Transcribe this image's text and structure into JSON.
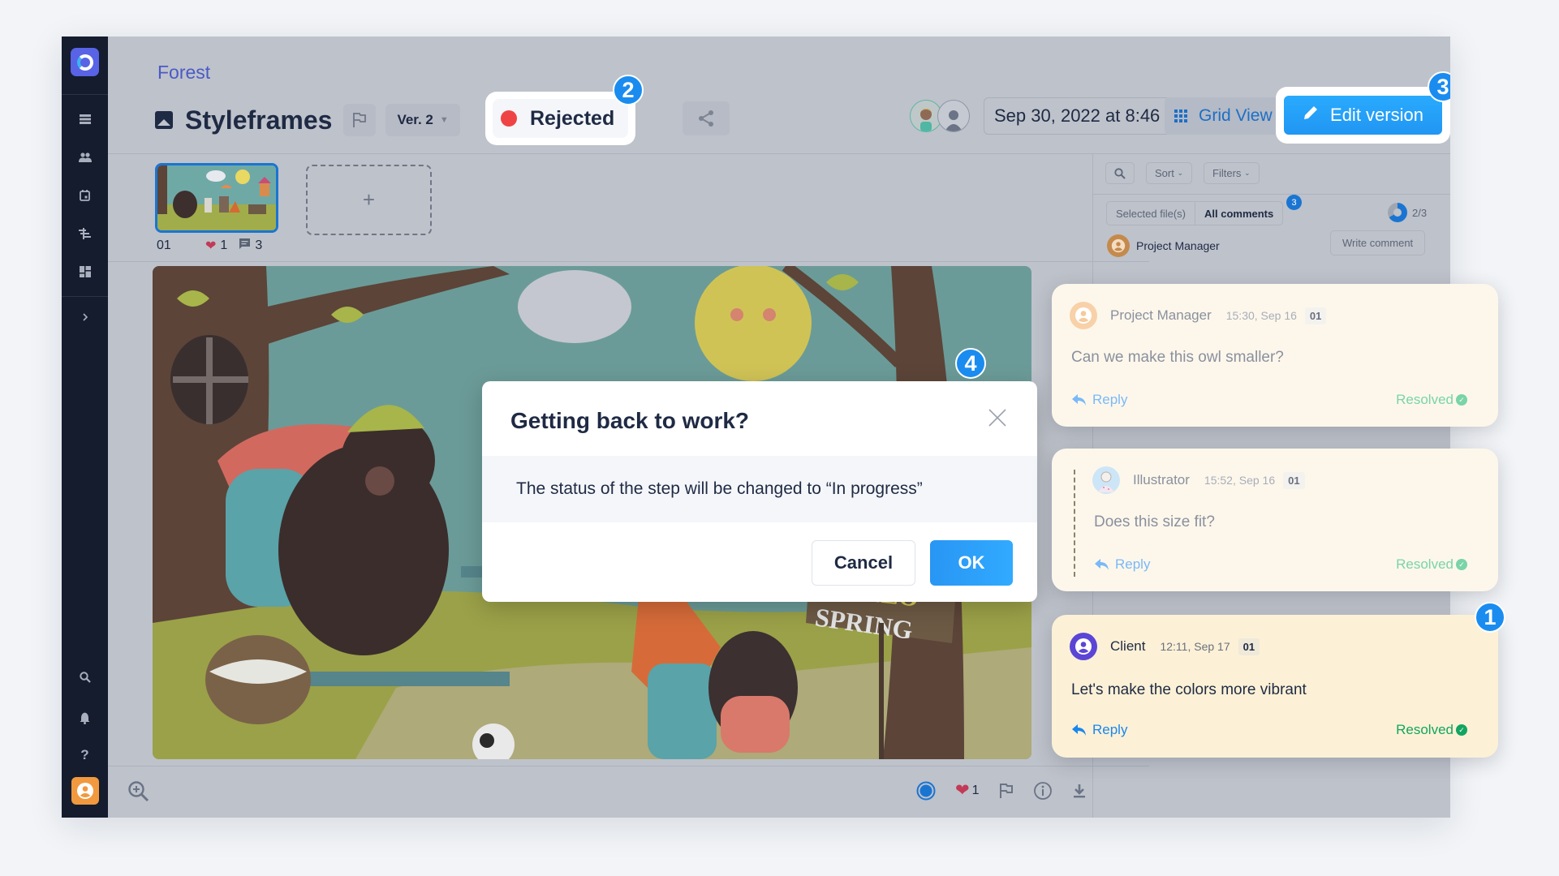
{
  "sidebar": {
    "nav_icons": [
      "list-icon",
      "team-icon",
      "calendar-icon",
      "timeline-icon",
      "dashboard-icon"
    ],
    "expand_icon": "chevron-right-icon",
    "bottom_icons": [
      "search-icon",
      "bell-icon",
      "help-icon"
    ],
    "help_glyph": "?"
  },
  "header": {
    "breadcrumb": "Forest",
    "title": "Styleframes",
    "version": "Ver. 2",
    "status": {
      "label": "Rejected",
      "color": "#ef4444"
    },
    "date": "Sep 30, 2022 at 8:46",
    "grid_view_label": "Grid View",
    "edit_version_label": "Edit version",
    "accent": "#2196f3"
  },
  "callouts": {
    "c1": "1",
    "c2": "2",
    "c3": "3",
    "c4": "4"
  },
  "thumbnails": {
    "items": [
      {
        "number": "01",
        "likes": "1",
        "comments": "3"
      }
    ],
    "add_label": "+"
  },
  "bottom_bar": {
    "likes": "1"
  },
  "right_panel": {
    "sort_label": "Sort",
    "filters_label": "Filters",
    "tabs": [
      "Selected file(s)",
      "All comments"
    ],
    "all_comments_count": "3",
    "resolved_progress_text": "2/3",
    "resolved_fraction": 0.667,
    "current_user": "Project Manager",
    "write_comment_label": "Write comment"
  },
  "comments": [
    {
      "author": "Project Manager",
      "time": "15:30, Sep 16",
      "frame": "01",
      "text": "Can we make this owl smaller?",
      "reply_label": "Reply",
      "status": "Resolved"
    },
    {
      "author": "Illustrator",
      "time": "15:52, Sep 16",
      "frame": "01",
      "text": "Does this size fit?",
      "reply_label": "Reply",
      "status": "Resolved"
    },
    {
      "author": "Client",
      "time": "12:11, Sep 17",
      "frame": "01",
      "text": "Let's make the colors more vibrant",
      "reply_label": "Reply",
      "status": "Resolved"
    }
  ],
  "modal": {
    "title": "Getting back to work?",
    "message": "The status of the step will be changed to “In progress”",
    "cancel_label": "Cancel",
    "ok_label": "OK"
  },
  "artwork": {
    "sign_line1": "HELLO",
    "sign_line2": "SPRING"
  }
}
